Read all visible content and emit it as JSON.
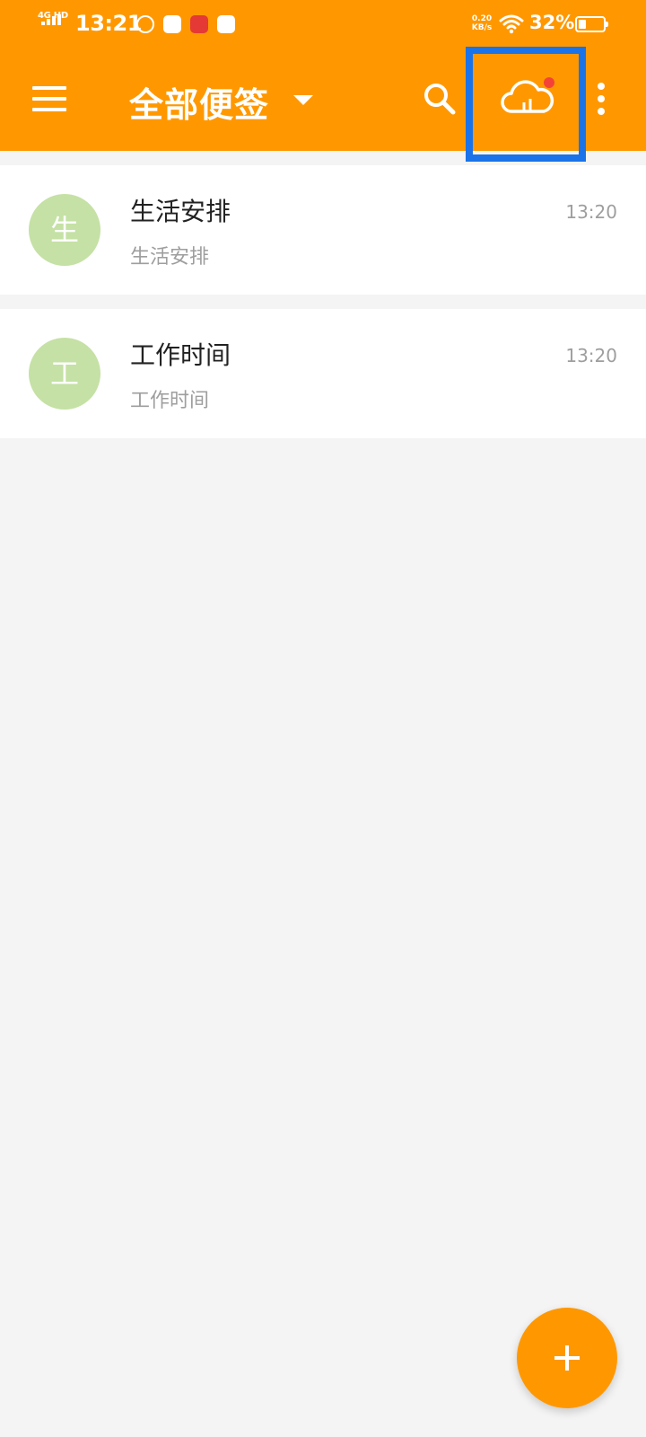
{
  "colors": {
    "accent": "#ff9800",
    "highlight_border": "#1a73e8",
    "avatar_bg": "#c5e1a5",
    "badge_dot": "#f44336"
  },
  "status_bar": {
    "network": "4G HD",
    "time": "13:21",
    "speed_value": "0.20",
    "speed_unit": "KB/s",
    "battery_percent": "32%",
    "battery_level": 0.32,
    "notification_icons": [
      "app-notification-icon",
      "shopping-bag-icon",
      "news-app-icon",
      "chat-app-icon"
    ]
  },
  "app_bar": {
    "title": "全部便签",
    "icons": {
      "menu": "hamburger-menu-icon",
      "dropdown": "caret-down-icon",
      "search": "search-icon",
      "sync": "cloud-sync-icon",
      "more": "more-vertical-icon"
    }
  },
  "notes": [
    {
      "avatar_letter": "生",
      "title": "生活安排",
      "preview": "生活安排",
      "time": "13:20"
    },
    {
      "avatar_letter": "工",
      "title": "工作时间",
      "preview": "工作时间",
      "time": "13:20"
    }
  ],
  "fab": {
    "icon": "plus-icon"
  }
}
